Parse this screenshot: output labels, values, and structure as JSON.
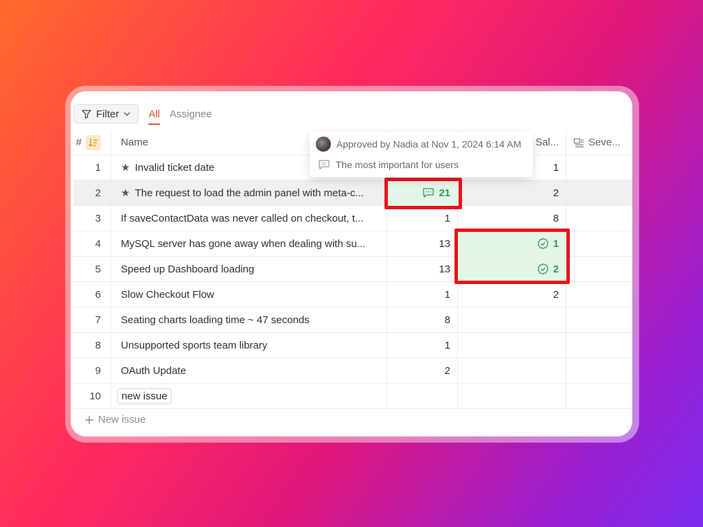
{
  "toolbar": {
    "filter_label": "Filter",
    "tab_all": "All",
    "tab_assignee": "Assignee"
  },
  "table": {
    "header": {
      "num": "#",
      "name": "Name",
      "col_b": "Sal...",
      "col_c": "Seve..."
    },
    "rows": [
      {
        "num": "1",
        "name": "Invalid ticket date",
        "a": "",
        "b": "1",
        "starred": true
      },
      {
        "num": "2",
        "name": "The request to load the admin panel with meta-c...",
        "a": "21",
        "b": "2",
        "starred": true
      },
      {
        "num": "3",
        "name": "If saveContactData was never called on checkout, t...",
        "a": "1",
        "b": "8"
      },
      {
        "num": "4",
        "name": "MySQL server has gone away when dealing with su...",
        "a": "13",
        "b": "1"
      },
      {
        "num": "5",
        "name": "Speed up Dashboard loading",
        "a": "13",
        "b": "2"
      },
      {
        "num": "6",
        "name": "Slow Checkout Flow",
        "a": "1",
        "b": "2"
      },
      {
        "num": "7",
        "name": "Seating charts loading time ~ 47 seconds",
        "a": "8",
        "b": ""
      },
      {
        "num": "8",
        "name": "Unsupported sports team library",
        "a": "1",
        "b": ""
      },
      {
        "num": "9",
        "name": "OAuth Update",
        "a": "2",
        "b": ""
      },
      {
        "num": "10",
        "name": "new issue",
        "a": "",
        "b": ""
      }
    ],
    "new_issue_label": "New issue"
  },
  "tooltip": {
    "approved": "Approved by Nadia at Nov 1, 2024 6:14 AM",
    "comment": "The most important for users"
  },
  "colors": {
    "accent": "#e0502a",
    "green": "#2d9a52",
    "highlight_border": "#e8141a"
  },
  "icons": [
    "filter-icon",
    "chevron-down-icon",
    "sort-icon",
    "star-icon",
    "comment-icon",
    "verified-check-icon",
    "plus-icon",
    "column-icon"
  ]
}
